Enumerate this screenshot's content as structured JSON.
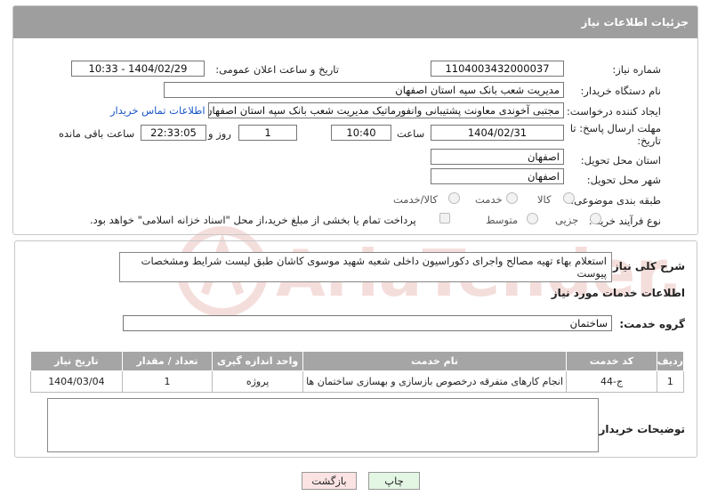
{
  "panel_title": "جزئیات اطلاعات نیاز",
  "fields": {
    "need_number_label": "شماره نیاز:",
    "need_number": "1104003432000037",
    "announce_label": "تاریخ و ساعت اعلان عمومی:",
    "announce_value": "1404/02/29 - 10:33",
    "buyer_org_label": "نام دستگاه خریدار:",
    "buyer_org": "مدیریت شعب بانک سپه استان اصفهان",
    "requester_label": "ایجاد کننده درخواست:",
    "requester": "مجتبی آخوندی معاونت پشتیبانی وانفورماتیک مدیریت شعب بانک سپه استان اصفهان",
    "contact_link": "اطلاعات تماس خریدار",
    "deadline_label_1": "مهلت ارسال پاسخ: تا",
    "deadline_label_2": "تاریخ:",
    "deadline_date": "1404/02/31",
    "time_label": "ساعت",
    "deadline_time": "10:40",
    "days_value": "1",
    "days_label": "روز و",
    "remaining_time": "22:33:05",
    "remaining_label": "ساعت باقی مانده",
    "province_label": "استان محل تحویل:",
    "province": "اصفهان",
    "city_label": "شهر محل تحویل:",
    "city": "اصفهان",
    "category_label": "طبقه بندی موضوعی:",
    "category_options": [
      "کالا",
      "خدمت",
      "کالا/خدمت"
    ],
    "process_label": "نوع فرآیند خرید :",
    "process_options": [
      "جزیی",
      "متوسط"
    ],
    "payment_note": "پرداخت تمام یا بخشی از مبلغ خرید،از محل \"اسناد خزانه اسلامی\" خواهد بود."
  },
  "summary_label": "شرح کلی نیاز:",
  "summary": "استعلام بهاء تهیه مصالح واجرای دکوراسیون داخلی شعبه شهید موسوی کاشان طبق لیست شرایط ومشخصات پیوست",
  "services_title": "اطلاعات خدمات مورد نیاز",
  "service_group_label": "گروه خدمت:",
  "service_group": "ساختمان",
  "table": {
    "headers": [
      "ردیف",
      "کد خدمت",
      "نام خدمت",
      "واحد اندازه گیری",
      "تعداد / مقدار",
      "تاریخ نیاز"
    ],
    "rows": [
      [
        "1",
        "ج-44",
        "انجام کارهای متفرقه درخصوص بازسازی و بهسازی ساختمان ها",
        "پروژه",
        "1",
        "1404/03/04"
      ]
    ]
  },
  "buyer_notes_label": "توضیحات خریدار:",
  "buttons": {
    "print": "چاپ",
    "back": "بازگشت"
  },
  "watermark_text": "AriaTender.neT",
  "colors": {
    "header_bg": "#9e9e9e",
    "link": "#1a56c8",
    "back_btn_bg": "#fbe3e3",
    "print_btn_bg": "#e3f5e3",
    "watermark": "#c0392b"
  }
}
